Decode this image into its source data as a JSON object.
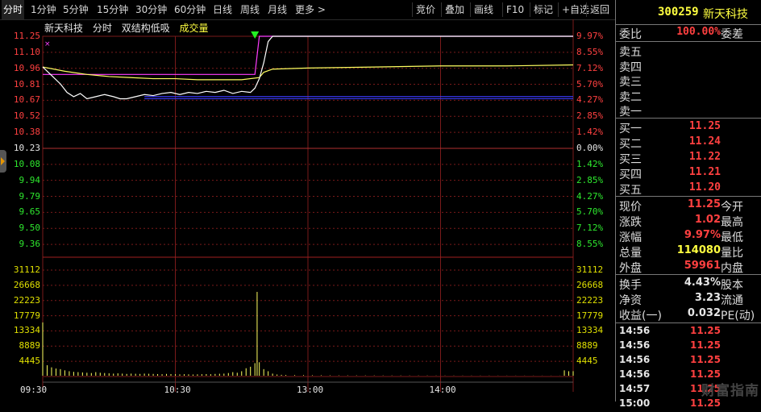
{
  "toolbar": {
    "left": [
      "分时",
      "1分钟",
      "5分钟",
      "15分钟",
      "30分钟",
      "60分钟",
      "日线",
      "周线",
      "月线",
      "更多 >"
    ],
    "right": [
      "竞价",
      "叠加",
      "画线",
      "F10",
      "标记",
      "+自选",
      "返回"
    ]
  },
  "caption": {
    "name": "新天科技",
    "mode": "分时",
    "indicator": "双结构低吸",
    "volume": "成交量"
  },
  "chart_data": {
    "type": "line",
    "prev_close": 10.23,
    "price_axis": {
      "ticks": [
        "11.25",
        "11.10",
        "10.96",
        "10.81",
        "10.67",
        "10.52",
        "10.38",
        "10.23",
        "10.08",
        "9.94",
        "9.79",
        "9.65",
        "9.50",
        "9.36"
      ],
      "pct_ticks": [
        "9.97%",
        "8.55%",
        "7.12%",
        "5.70%",
        "4.27%",
        "2.85%",
        "1.42%",
        "0.00%",
        "1.42%",
        "2.85%",
        "4.27%",
        "5.70%",
        "7.12%",
        "8.55%"
      ]
    },
    "volume_axis": {
      "ticks": [
        "31112",
        "26668",
        "22223",
        "17779",
        "13334",
        "8889",
        "4445"
      ]
    },
    "x_labels": [
      "09:30",
      "10:30",
      "13:00",
      "14:00"
    ],
    "series": [
      {
        "values": [
          [
            0,
            10.96
          ],
          [
            4,
            10.88
          ],
          [
            8,
            10.8
          ],
          [
            11,
            10.72
          ],
          [
            14,
            10.68
          ],
          [
            17,
            10.71
          ],
          [
            20,
            10.66
          ],
          [
            24,
            10.68
          ],
          [
            28,
            10.7
          ],
          [
            32,
            10.68
          ],
          [
            35,
            10.66
          ],
          [
            38,
            10.66
          ],
          [
            42,
            10.68
          ],
          [
            46,
            10.7
          ],
          [
            50,
            10.69
          ],
          [
            54,
            10.71
          ],
          [
            58,
            10.72
          ],
          [
            62,
            10.7
          ],
          [
            66,
            10.72
          ],
          [
            70,
            10.71
          ],
          [
            74,
            10.73
          ],
          [
            78,
            10.72
          ],
          [
            82,
            10.74
          ],
          [
            86,
            10.71
          ],
          [
            90,
            10.73
          ],
          [
            94,
            10.72
          ],
          [
            96,
            10.76
          ],
          [
            98,
            10.85
          ],
          [
            100,
            11.0
          ],
          [
            102,
            11.2
          ],
          [
            104,
            11.25
          ],
          [
            240,
            11.25
          ]
        ]
      },
      {
        "values": [
          [
            0,
            10.96
          ],
          [
            10,
            10.92
          ],
          [
            20,
            10.89
          ],
          [
            30,
            10.87
          ],
          [
            40,
            10.86
          ],
          [
            50,
            10.85
          ],
          [
            60,
            10.85
          ],
          [
            70,
            10.84
          ],
          [
            80,
            10.84
          ],
          [
            90,
            10.84
          ],
          [
            98,
            10.86
          ],
          [
            100,
            10.91
          ],
          [
            104,
            10.94
          ],
          [
            120,
            10.95
          ],
          [
            150,
            10.96
          ],
          [
            180,
            10.97
          ],
          [
            210,
            10.97
          ],
          [
            240,
            10.98
          ]
        ]
      }
    ],
    "overlay_levels": [
      11.25,
      10.89,
      10.68,
      10.66
    ],
    "volumes": [
      [
        0,
        17800
      ],
      [
        2,
        3500
      ],
      [
        4,
        2800
      ],
      [
        6,
        2400
      ],
      [
        8,
        2200
      ],
      [
        10,
        1800
      ],
      [
        12,
        1500
      ],
      [
        14,
        1300
      ],
      [
        16,
        1200
      ],
      [
        18,
        1100
      ],
      [
        20,
        1000
      ],
      [
        22,
        900
      ],
      [
        24,
        1200
      ],
      [
        26,
        1000
      ],
      [
        28,
        900
      ],
      [
        30,
        800
      ],
      [
        32,
        700
      ],
      [
        34,
        800
      ],
      [
        36,
        700
      ],
      [
        38,
        600
      ],
      [
        40,
        700
      ],
      [
        42,
        650
      ],
      [
        44,
        600
      ],
      [
        46,
        700
      ],
      [
        48,
        650
      ],
      [
        50,
        600
      ],
      [
        52,
        550
      ],
      [
        54,
        500
      ],
      [
        56,
        600
      ],
      [
        58,
        550
      ],
      [
        60,
        500
      ],
      [
        62,
        450
      ],
      [
        64,
        500
      ],
      [
        66,
        450
      ],
      [
        68,
        400
      ],
      [
        70,
        450
      ],
      [
        72,
        500
      ],
      [
        74,
        550
      ],
      [
        76,
        500
      ],
      [
        78,
        600
      ],
      [
        80,
        650
      ],
      [
        82,
        700
      ],
      [
        84,
        900
      ],
      [
        86,
        1200
      ],
      [
        88,
        1000
      ],
      [
        90,
        1500
      ],
      [
        92,
        2500
      ],
      [
        94,
        3000
      ],
      [
        96,
        4200
      ],
      [
        97,
        28000
      ],
      [
        98,
        4500
      ],
      [
        100,
        2200
      ],
      [
        102,
        1500
      ],
      [
        104,
        700
      ],
      [
        106,
        400
      ],
      [
        108,
        300
      ],
      [
        110,
        250
      ],
      [
        114,
        200
      ],
      [
        118,
        200
      ],
      [
        122,
        150
      ],
      [
        126,
        150
      ],
      [
        130,
        120
      ],
      [
        134,
        100
      ],
      [
        138,
        100
      ],
      [
        142,
        100
      ],
      [
        146,
        90
      ],
      [
        150,
        90
      ],
      [
        154,
        80
      ],
      [
        158,
        80
      ],
      [
        162,
        80
      ],
      [
        166,
        70
      ],
      [
        170,
        70
      ],
      [
        174,
        70
      ],
      [
        178,
        60
      ],
      [
        182,
        60
      ],
      [
        186,
        60
      ],
      [
        190,
        50
      ],
      [
        194,
        50
      ],
      [
        198,
        50
      ],
      [
        202,
        50
      ],
      [
        206,
        45
      ],
      [
        210,
        45
      ],
      [
        214,
        40
      ],
      [
        218,
        40
      ],
      [
        222,
        40
      ],
      [
        226,
        35
      ],
      [
        230,
        35
      ],
      [
        234,
        30
      ],
      [
        236,
        1800
      ],
      [
        238,
        1500
      ],
      [
        240,
        1500
      ]
    ],
    "colors": {
      "price": "#ffffff",
      "avg": "#ffff60",
      "limit": "#ff3cff",
      "low": "#3c3cff",
      "volume": "#ffff60",
      "grid": "#7a1a1a"
    },
    "marker": "green-down-arrow-at-limit-up"
  },
  "panel": {
    "code": "300259",
    "name": "新天科技",
    "webi_label": "委比",
    "webi_value": "100.00%",
    "wecha_label": "委差",
    "sells": [
      "卖五",
      "卖四",
      "卖三",
      "卖二",
      "卖一"
    ],
    "buys": [
      {
        "label": "买一",
        "price": "11.25"
      },
      {
        "label": "买二",
        "price": "11.24"
      },
      {
        "label": "买三",
        "price": "11.22"
      },
      {
        "label": "买四",
        "price": "11.21"
      },
      {
        "label": "买五",
        "price": "11.20"
      }
    ],
    "stats": [
      {
        "l": "现价",
        "v": "11.25",
        "color": "#ff4040",
        "r": "今开"
      },
      {
        "l": "涨跌",
        "v": "1.02",
        "color": "#ff4040",
        "r": "最高"
      },
      {
        "l": "涨幅",
        "v": "9.97%",
        "color": "#ff4040",
        "r": "最低"
      },
      {
        "l": "总量",
        "v": "114080",
        "color": "#ffff40",
        "r": "量比"
      },
      {
        "l": "外盘",
        "v": "59961",
        "color": "#ff4040",
        "r": "内盘"
      }
    ],
    "stats2": [
      {
        "l": "换手",
        "v": "4.43%",
        "color": "#e6e6e6",
        "r": "股本"
      },
      {
        "l": "净资",
        "v": "3.23",
        "color": "#e6e6e6",
        "r": "流通"
      },
      {
        "l": "收益(一)",
        "v": "0.032",
        "color": "#e6e6e6",
        "r": "PE(动)"
      }
    ],
    "ticks": [
      {
        "t": "14:56",
        "p": "11.25"
      },
      {
        "t": "14:56",
        "p": "11.25"
      },
      {
        "t": "14:56",
        "p": "11.25"
      },
      {
        "t": "14:56",
        "p": "11.25"
      },
      {
        "t": "14:57",
        "p": "11.25"
      },
      {
        "t": "15:00",
        "p": "11.25"
      }
    ]
  },
  "watermark": "财富指南"
}
